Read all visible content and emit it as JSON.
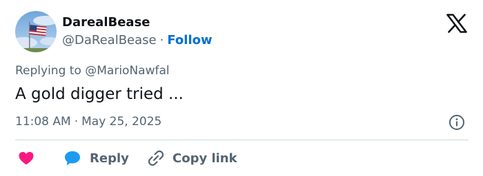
{
  "author": {
    "display_name": "DarealBease",
    "handle": "@DaRealBease",
    "separator": "·",
    "follow_label": "Follow",
    "avatar_icon": "us-flag-avatar"
  },
  "brand": {
    "logo_icon": "x-logo-icon"
  },
  "reply_context": {
    "text": "Replying to @MarioNawfal"
  },
  "tweet": {
    "text": "A gold digger tried ..."
  },
  "meta": {
    "time": "11:08 AM",
    "separator": "·",
    "date": "May 25, 2025",
    "info_icon": "info-icon"
  },
  "actions": {
    "like_icon": "heart-icon",
    "reply_icon": "speech-bubble-icon",
    "reply_label": "Reply",
    "copy_icon": "link-icon",
    "copy_label": "Copy link"
  },
  "colors": {
    "text_primary": "#0f1419",
    "text_secondary": "#536471",
    "link_blue": "#006fd6",
    "like_pink": "#f91880",
    "reply_blue": "#1d9bf0",
    "divider": "#cfd9de"
  }
}
